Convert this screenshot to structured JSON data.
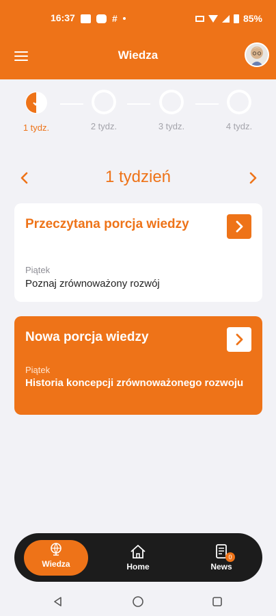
{
  "status_bar": {
    "time": "16:37",
    "hash_icon": "#",
    "battery": "85%"
  },
  "header": {
    "title": "Wiedza",
    "avatar_icon": "avatar-icon"
  },
  "stepper": {
    "steps": [
      {
        "label": "1 tydz.",
        "state": "active-half"
      },
      {
        "label": "2 tydz.",
        "state": "empty"
      },
      {
        "label": "3 tydz.",
        "state": "empty"
      },
      {
        "label": "4 tydz.",
        "state": "empty"
      }
    ]
  },
  "week_nav": {
    "title": "1 tydzień"
  },
  "cards": [
    {
      "title": "Przeczytana porcja wiedzy",
      "day": "Piątek",
      "subtitle": "Poznaj zrównoważony rozwój"
    },
    {
      "title": "Nowa porcja wiedzy",
      "day": "Piątek",
      "subtitle": "Historia koncepcji zrównoważonego rozwoju"
    }
  ],
  "bottom_nav": {
    "items": [
      {
        "label": "Wiedza",
        "icon": "globe-icon",
        "active": true
      },
      {
        "label": "Home",
        "icon": "home-icon",
        "active": false
      },
      {
        "label": "News",
        "icon": "news-icon",
        "active": false,
        "badge": "0"
      }
    ]
  },
  "colors": {
    "accent": "#ee7318",
    "nav_bg": "#1c1c1c",
    "page_bg": "#f2f2f6"
  }
}
